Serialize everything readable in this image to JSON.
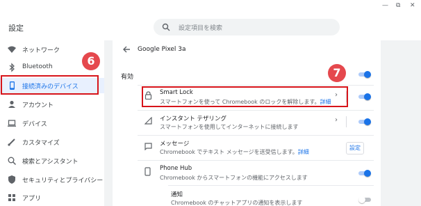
{
  "app": {
    "title": "設定",
    "search_placeholder": "設定項目を検索",
    "window_controls": [
      "—",
      "⧉",
      "✕"
    ]
  },
  "sidebar": {
    "items": [
      {
        "label": "ネットワーク",
        "icon": "wifi-icon",
        "active": false
      },
      {
        "label": "Bluetooth",
        "icon": "bluetooth-icon",
        "active": false
      },
      {
        "label": "接続済みのデバイス",
        "icon": "phone-icon",
        "active": true
      },
      {
        "label": "アカウント",
        "icon": "person-icon",
        "active": false
      },
      {
        "label": "デバイス",
        "icon": "laptop-icon",
        "active": false
      },
      {
        "label": "カスタマイズ",
        "icon": "brush-icon",
        "active": false
      },
      {
        "label": "検索とアシスタント",
        "icon": "search-icon",
        "active": false
      },
      {
        "label": "セキュリティとプライバシー",
        "icon": "shield-icon",
        "active": false
      },
      {
        "label": "アプリ",
        "icon": "apps-icon",
        "active": false
      }
    ]
  },
  "content": {
    "page_title": "Google Pixel 3a",
    "section_label": "有効",
    "rows": [
      {
        "title": "Smart Lock",
        "desc": "スマートフォンを使って Chromebook のロックを解除します。",
        "link": "詳細",
        "icon": "lock-icon",
        "toggle": true
      },
      {
        "title": "インスタント テザリング",
        "desc": "スマートフォンを使用してインターネットに接続します",
        "link": "",
        "icon": "signal-icon",
        "toggle": true
      },
      {
        "title": "メッセージ",
        "desc": "Chromebook でテキスト メッセージを送受信します。",
        "link": "詳細",
        "icon": "message-icon",
        "button": "設定"
      },
      {
        "title": "Phone Hub",
        "desc": "Chromebook からスマートフォンの機能にアクセスします",
        "link": "",
        "icon": "phone-icon",
        "toggle": true
      },
      {
        "title": "通知",
        "desc": "Chromebook のチャットアプリの通知を表示します",
        "link": "",
        "toggle": false
      }
    ]
  },
  "annotations": {
    "sidebar_step": "6",
    "smartlock_step": "7"
  },
  "colors": {
    "accent": "#1a73e8",
    "highlight_red": "#d7141a",
    "step_circle": "#e5484d"
  }
}
